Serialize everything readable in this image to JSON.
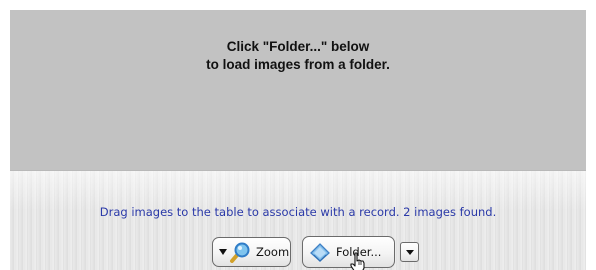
{
  "preview": {
    "message_line1": "Click \"Folder...\" below",
    "message_line2": "to load images from a folder."
  },
  "status": {
    "text": "Drag images to the table to associate with a record. 2 images found."
  },
  "toolbar": {
    "zoom_label": "Zoom",
    "folder_label": "Folder..."
  },
  "icons": {
    "zoom": "magnifier-icon",
    "folder": "folder-icon",
    "menu": "dropdown-arrow-icon",
    "cursor": "hand-cursor-icon"
  },
  "colors": {
    "status_text": "#2a39a8",
    "preview_bg": "#c2c2c2"
  }
}
